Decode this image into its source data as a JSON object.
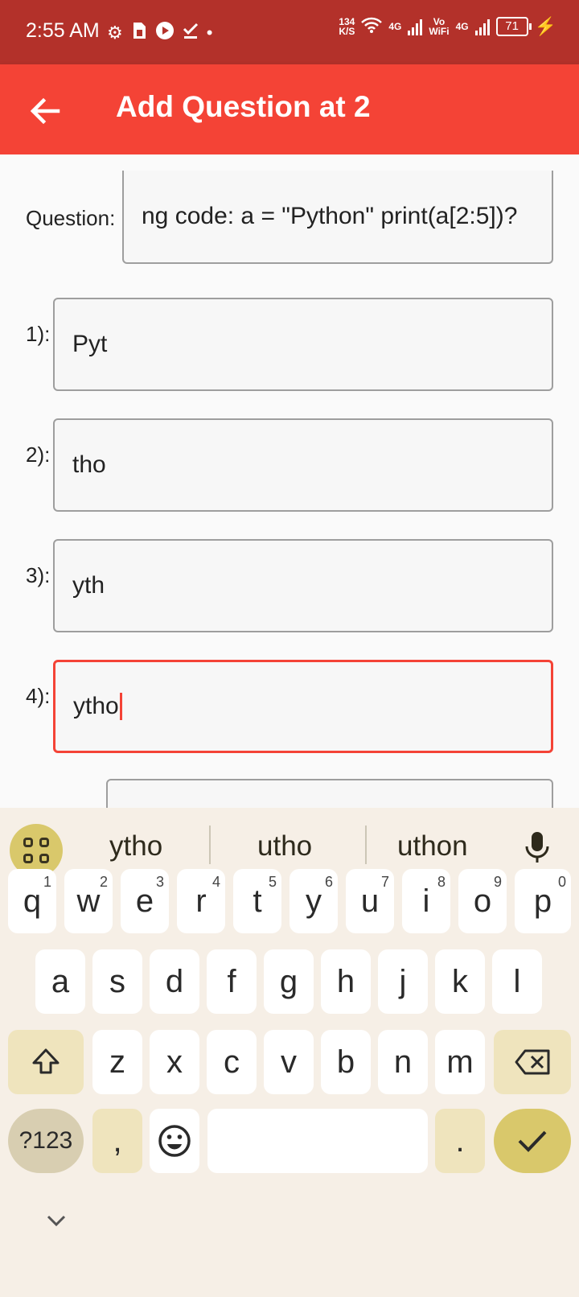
{
  "status_bar": {
    "time": "2:55 AM",
    "speed_value": "134",
    "speed_unit": "K/S",
    "net1": "4G",
    "volte_top": "Vo",
    "volte_bottom": "WiFi",
    "net2": "4G",
    "battery": "71",
    "icons": [
      "gear-icon",
      "sim-icon",
      "media-icon",
      "check-icon",
      "dot-icon",
      "wifi-icon",
      "signal-icon",
      "battery-icon",
      "charging-icon"
    ]
  },
  "app_bar": {
    "title": "Add Question at 2",
    "back_icon": "arrow-back-icon"
  },
  "form": {
    "question_label": "Question:",
    "question_value": "ng code: a = \"Python\" print(a[2:5])?",
    "options": [
      {
        "label": "1):",
        "value": "Pyt"
      },
      {
        "label": "2):",
        "value": "tho"
      },
      {
        "label": "3):",
        "value": "yth"
      },
      {
        "label": "4):",
        "value": "ytho"
      }
    ],
    "focused_option_index": 3
  },
  "keyboard": {
    "suggestions": [
      "ytho",
      "utho",
      "uthon"
    ],
    "row1": [
      "q",
      "w",
      "e",
      "r",
      "t",
      "y",
      "u",
      "i",
      "o",
      "p"
    ],
    "row1_hints": [
      "1",
      "2",
      "3",
      "4",
      "5",
      "6",
      "7",
      "8",
      "9",
      "0"
    ],
    "row2": [
      "a",
      "s",
      "d",
      "f",
      "g",
      "h",
      "j",
      "k",
      "l"
    ],
    "row3": [
      "z",
      "x",
      "c",
      "v",
      "b",
      "n",
      "m"
    ],
    "sym_label": "?123",
    "comma": ",",
    "period": ".",
    "colors": {
      "accent": "#d9c86b",
      "background": "#f6efe6",
      "modifier": "#efe4bd"
    }
  },
  "colors": {
    "status_bar": "#b3312a",
    "app_bar": "#f44336",
    "focus": "#f44336"
  }
}
